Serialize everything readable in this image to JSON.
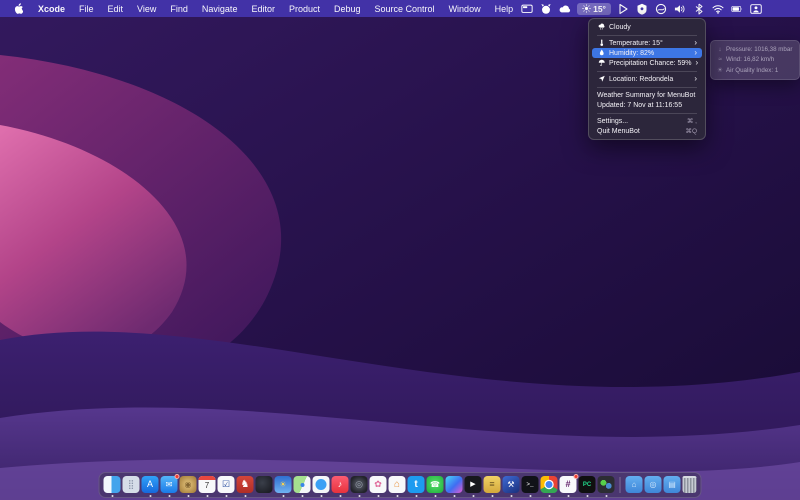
{
  "menubar": {
    "left_items": [
      {
        "label": "Xcode",
        "bold": true
      },
      {
        "label": "File"
      },
      {
        "label": "Edit"
      },
      {
        "label": "View"
      },
      {
        "label": "Find"
      },
      {
        "label": "Navigate"
      },
      {
        "label": "Editor"
      },
      {
        "label": "Product"
      },
      {
        "label": "Debug"
      },
      {
        "label": "Source Control"
      },
      {
        "label": "Window"
      },
      {
        "label": "Help"
      }
    ],
    "weather": {
      "temp": "15°"
    },
    "right_icons_before": [
      "display",
      "pet-face",
      "cloud"
    ],
    "right_icons_after": [
      "play",
      "shield",
      "status-circle",
      "volume",
      "bluetooth",
      "wifi",
      "battery",
      "user-switch"
    ]
  },
  "menu": {
    "items": [
      {
        "type": "item",
        "id": "cloudy",
        "icon": "cloud-rain",
        "label": "Cloudy"
      },
      {
        "type": "sep"
      },
      {
        "type": "item",
        "id": "temperature",
        "icon": "thermometer",
        "label": "Temperature: 15°",
        "chevron": true
      },
      {
        "type": "item",
        "id": "humidity",
        "icon": "drop",
        "label": "Humidity: 82%",
        "chevron": true,
        "highlight": true
      },
      {
        "type": "item",
        "id": "precipitation",
        "icon": "umbrella",
        "label": "Precipitation Chance: 59%",
        "chevron": true
      },
      {
        "type": "sep"
      },
      {
        "type": "item",
        "id": "location",
        "icon": "location-arrow",
        "label": "Location: Redondela",
        "chevron": true
      },
      {
        "type": "sep"
      },
      {
        "type": "info",
        "id": "summary",
        "label": "Weather Summary for MenuBot"
      },
      {
        "type": "info",
        "id": "updated",
        "label": "Updated: 7 Nov at 11:16:55"
      },
      {
        "type": "sep"
      },
      {
        "type": "action",
        "id": "settings",
        "label": "Settings...",
        "shortcut": "⌘ ,"
      },
      {
        "type": "action",
        "id": "quit",
        "label": "Quit MenuBot",
        "shortcut": "⌘Q"
      }
    ]
  },
  "submenu": {
    "items": [
      {
        "id": "pressure",
        "icon": "↓",
        "label": "Pressure: 1016,38 mbar"
      },
      {
        "id": "wind",
        "icon": "≈",
        "label": "Wind: 16,82 km/h"
      },
      {
        "id": "air-quality",
        "icon": "☀",
        "label": "Air Quality Index: 1"
      }
    ]
  },
  "colors": {
    "accent_blue": "#3d76e5",
    "menubar_bg": "#4334ac",
    "menu_bg": "#2d283a",
    "badge_red": "#ee3b2f"
  },
  "dock": {
    "items": [
      {
        "name": "finder",
        "bg": "linear-gradient(90deg,#f2f7fc 0 48%,#43a4ec 48%)",
        "running": true
      },
      {
        "name": "launchpad",
        "bg": "#d5dde8",
        "glyph": "⣿",
        "fg": "#8b97ab",
        "size": "9px"
      },
      {
        "name": "app-store",
        "bg": "linear-gradient(180deg,#30a2f8,#1668dc)",
        "glyph": "A",
        "fg": "#fff",
        "size": "9px",
        "running": true
      },
      {
        "name": "mail",
        "bg": "linear-gradient(180deg,#54b5fa,#1a7ae8)",
        "glyph": "✉",
        "fg": "#fff",
        "size": "8px",
        "badge": true,
        "running": true
      },
      {
        "name": "gold-app",
        "bg": "radial-gradient(circle,#d8b670 20%,#a9833f 85%)",
        "glyph": "◉",
        "fg": "rgba(115,86,38,.85)",
        "size": "8px",
        "running": true
      },
      {
        "name": "calendar",
        "bg": "#f7f8fa",
        "glyph": "7",
        "fg": "#333",
        "size": "8px",
        "caltop": true,
        "running": true
      },
      {
        "name": "reminders",
        "bg": "#f7f8fa",
        "glyph": "☑",
        "fg": "#2a4fa0",
        "size": "9px",
        "running": true
      },
      {
        "name": "chess",
        "bg": "linear-gradient(180deg,#d4453a,#b02e26)",
        "glyph": "♞",
        "fg": "#fff",
        "size": "10px",
        "running": true
      },
      {
        "name": "dark-game",
        "bg": "radial-gradient(circle at 40% 40%,#3a3f4a,#15161c)"
      },
      {
        "name": "weather",
        "bg": "linear-gradient(180deg,#2f6fd0,#6fb1f2)",
        "glyph": "☀",
        "fg": "#ffd54a",
        "size": "8px",
        "running": true
      },
      {
        "name": "maps",
        "bg": "linear-gradient(115deg,#a5e08f 0 55%,#f5f7f9 55%)",
        "inner": {
          "color": "#3a86e8",
          "sz": 4
        },
        "running": true
      },
      {
        "name": "safari",
        "bg": "#f4f6f8",
        "inner": {
          "color": "#3aa0f5",
          "sz": 11
        },
        "running": true
      },
      {
        "name": "music",
        "bg": "linear-gradient(180deg,#fc5c72,#e7323c)",
        "glyph": "♪",
        "fg": "#fff",
        "size": "9px",
        "running": true
      },
      {
        "name": "lens-app",
        "bg": "radial-gradient(circle,#4a4e59 25%,#23242b 72%)",
        "glyph": "◎",
        "fg": "#9aa0ac",
        "size": "9px",
        "running": true
      },
      {
        "name": "photos",
        "bg": "#f7f8fa",
        "glyph": "✿",
        "fg": "#e0689a",
        "size": "9px",
        "running": true
      },
      {
        "name": "home",
        "bg": "#f7f8fa",
        "glyph": "⌂",
        "fg": "#e8913a",
        "size": "10px",
        "running": true
      },
      {
        "name": "twitter",
        "bg": "#1d9bf0",
        "glyph": "t",
        "fg": "#fff",
        "size": "10px",
        "bold": true,
        "running": true
      },
      {
        "name": "whatsapp",
        "bg": "radial-gradient(circle at 50% 45%,#57e06c,#1fae3a)",
        "glyph": "☎",
        "fg": "#fff",
        "size": "8px",
        "running": true
      },
      {
        "name": "shortcuts",
        "bg": "linear-gradient(135deg,#48d9f6,#3f6df2 55%,#e65bd0)",
        "running": true
      },
      {
        "name": "tv",
        "bg": "#17181d",
        "glyph": "▶",
        "fg": "#fff",
        "size": "7px",
        "running": true
      },
      {
        "name": "yellow-tool",
        "bg": "linear-gradient(180deg,#f0d264,#d4a83c)",
        "glyph": "≡",
        "fg": "#6b5420",
        "size": "9px",
        "running": true
      },
      {
        "name": "xcode",
        "bg": "linear-gradient(145deg,#3e6bd6,#1a2f7a)",
        "glyph": "⚒",
        "fg": "#fff",
        "size": "8px",
        "running": true
      },
      {
        "name": "terminal",
        "bg": "#111218",
        "glyph": ">_",
        "fg": "#fff",
        "size": "6px",
        "mono": true,
        "running": true
      },
      {
        "name": "chrome",
        "bg": "conic-gradient(#ea4335 0 120deg,#34a853 120deg 240deg,#fbbc05 240deg 360deg)",
        "inner": {
          "color": "#4285f4",
          "sz": 7,
          "ring": true
        },
        "running": true
      },
      {
        "name": "slack",
        "bg": "#f7f8fa",
        "glyph": "#",
        "fg": "#611f69",
        "size": "9px",
        "bold": true,
        "badge": true,
        "running": true
      },
      {
        "name": "pycharm",
        "bg": "#101010",
        "glyph": "PC",
        "fg": "#21d789",
        "size": "6px",
        "bold": true,
        "running": true
      },
      {
        "name": "sims-game",
        "bg": "radial-gradient(circle at 35% 40%,#57d04a 0 19%,transparent 20%),radial-gradient(circle at 66% 58%,#4a8bd0 0 19%,transparent 20%),#2c2d33",
        "running": true
      },
      {
        "name": "separator",
        "sep": true
      },
      {
        "name": "folder-home",
        "folder": true,
        "bg": "linear-gradient(180deg,#63aef0,#3f86d8)",
        "glyph": "⌂",
        "fg": "#cfe6fb",
        "size": "8px"
      },
      {
        "name": "folder-apps",
        "folder": true,
        "bg": "linear-gradient(180deg,#63aef0,#3f86d8)",
        "glyph": "◎",
        "fg": "#cfe6fb",
        "size": "8px"
      },
      {
        "name": "folder-docs",
        "folder": true,
        "bg": "linear-gradient(180deg,#63aef0,#3f86d8)",
        "glyph": "▤",
        "fg": "#cfe6fb",
        "size": "8px"
      },
      {
        "name": "trash",
        "bg": "repeating-linear-gradient(90deg,#c6cad2 0 1.5px,#8d939d 1.5px 3px)"
      }
    ]
  }
}
